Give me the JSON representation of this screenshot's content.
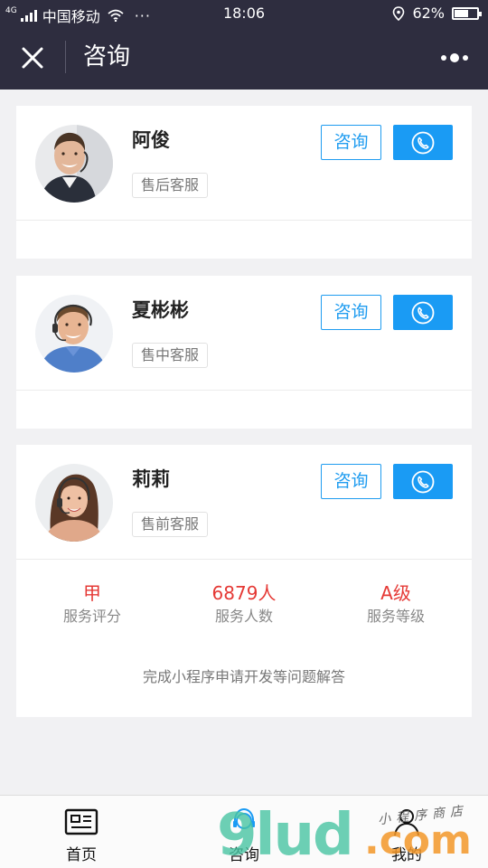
{
  "status_bar": {
    "network": "4G",
    "carrier": "中国移动",
    "dots": "···",
    "time": "18:06",
    "battery": "62%",
    "battery_level": 0.62
  },
  "nav": {
    "title": "咨询",
    "close_icon": "close-icon",
    "more_icon": "more-dots-icon"
  },
  "agents": [
    {
      "name": "阿俊",
      "tag": "售后客服",
      "consult_label": "咨询",
      "call_icon": "phone-icon"
    },
    {
      "name": "夏彬彬",
      "tag": "售中客服",
      "consult_label": "咨询",
      "call_icon": "phone-icon"
    },
    {
      "name": "莉莉",
      "tag": "售前客服",
      "consult_label": "咨询",
      "call_icon": "phone-icon"
    }
  ],
  "stats": [
    {
      "value": "甲",
      "label": "服务评分"
    },
    {
      "value": "6879人",
      "label": "服务人数"
    },
    {
      "value": "A级",
      "label": "服务等级"
    }
  ],
  "description": "完成小程序申请开发等问题解答",
  "tabs": [
    {
      "label": "首页",
      "icon": "home-card-icon"
    },
    {
      "label": "咨询",
      "icon": "headset-icon"
    },
    {
      "label": "我的",
      "icon": "user-icon"
    }
  ],
  "watermark": {
    "main": "9lud",
    "com": ".com",
    "sub": "小程序商店"
  },
  "colors": {
    "header_bg": "#2e2d3f",
    "accent_blue": "#1a9bf4",
    "stat_red": "#e53935"
  }
}
